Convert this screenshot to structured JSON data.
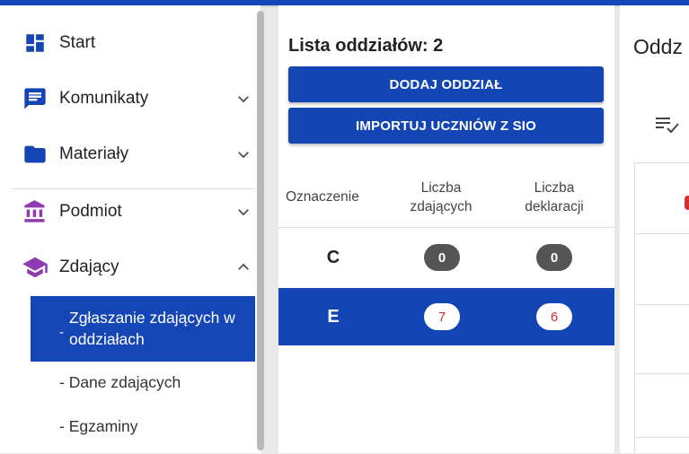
{
  "colors": {
    "primary": "#1346b4",
    "sidebar_icon_blue": "#1346b4",
    "sidebar_icon_purple": "#8e3ab0",
    "badge_dark": "#555555",
    "badge_text_red": "#d32f2f"
  },
  "sidebar": {
    "items": [
      {
        "label": "Start",
        "icon": "dashboard-icon"
      },
      {
        "label": "Komunikaty",
        "icon": "message-icon"
      },
      {
        "label": "Materiały",
        "icon": "folder-icon"
      },
      {
        "label": "Podmiot",
        "icon": "institution-icon"
      },
      {
        "label": "Zdający",
        "icon": "graduation-cap-icon"
      }
    ],
    "sub_items": [
      {
        "label": "Zgłaszanie zdających w oddziałach",
        "active": true
      },
      {
        "label": "- Dane zdających",
        "active": false
      },
      {
        "label": "- Egzaminy",
        "active": false
      }
    ],
    "active_dash": "-"
  },
  "middle": {
    "title": "Lista oddziałów: 2",
    "buttons": {
      "add": "DODAJ ODDZIAŁ",
      "import": "IMPORTUJ UCZNIÓW Z SIO"
    },
    "headers": {
      "designation": "Oznaczenie",
      "students_line1": "Liczba",
      "students_line2": "zdających",
      "declarations_line1": "Liczba",
      "declarations_line2": "deklaracji"
    },
    "rows": [
      {
        "designation": "C",
        "students": "0",
        "declarations": "0",
        "selected": false
      },
      {
        "designation": "E",
        "students": "7",
        "declarations": "6",
        "selected": true
      }
    ]
  },
  "right": {
    "title": "Oddz"
  }
}
